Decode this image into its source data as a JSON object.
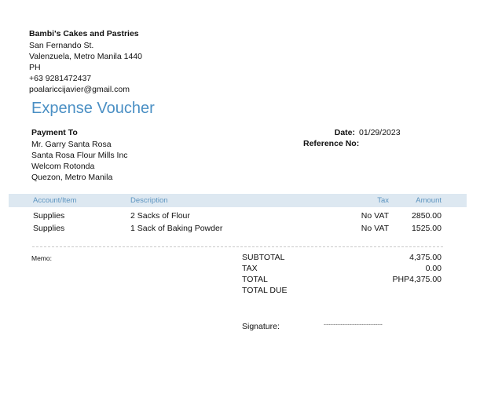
{
  "company": {
    "name": "Bambi's Cakes and Pastries",
    "address_line1": "San Fernando St.",
    "address_line2": "Valenzuela, Metro Manila  1440",
    "country": "PH",
    "phone": "+63 9281472437",
    "email": "poalariccijavier@gmail.com"
  },
  "document": {
    "title": "Expense Voucher",
    "date_label": "Date:",
    "date_value": "01/29/2023",
    "reference_label": "Reference No:",
    "reference_value": ""
  },
  "payee": {
    "heading": "Payment To",
    "lines": [
      "Mr. Garry Santa Rosa",
      "Santa Rosa Flour Mills Inc",
      "Welcom Rotonda",
      "Quezon, Metro Manila"
    ]
  },
  "table": {
    "headers": {
      "account": "Account/Item",
      "description": "Description",
      "tax": "Tax",
      "amount": "Amount"
    },
    "rows": [
      {
        "account": "Supplies",
        "description": "2 Sacks of Flour",
        "tax": "No VAT",
        "amount": "2850.00"
      },
      {
        "account": "Supplies",
        "description": "1 Sack of Baking Powder",
        "tax": "No VAT",
        "amount": "1525.00"
      }
    ]
  },
  "memo_label": "Memo:",
  "totals": {
    "subtotal_label": "SUBTOTAL",
    "subtotal_value": "4,375.00",
    "tax_label": "TAX",
    "tax_value": "0.00",
    "total_label": "TOTAL",
    "total_value": "PHP4,375.00",
    "total_due_label": "TOTAL DUE",
    "total_due_value": ""
  },
  "signature": {
    "label": "Signature:",
    "line": "-------------------------"
  },
  "colors": {
    "title": "#4a8fc4",
    "table_header_bg": "#dde8f1",
    "table_header_text": "#5b93bf"
  }
}
